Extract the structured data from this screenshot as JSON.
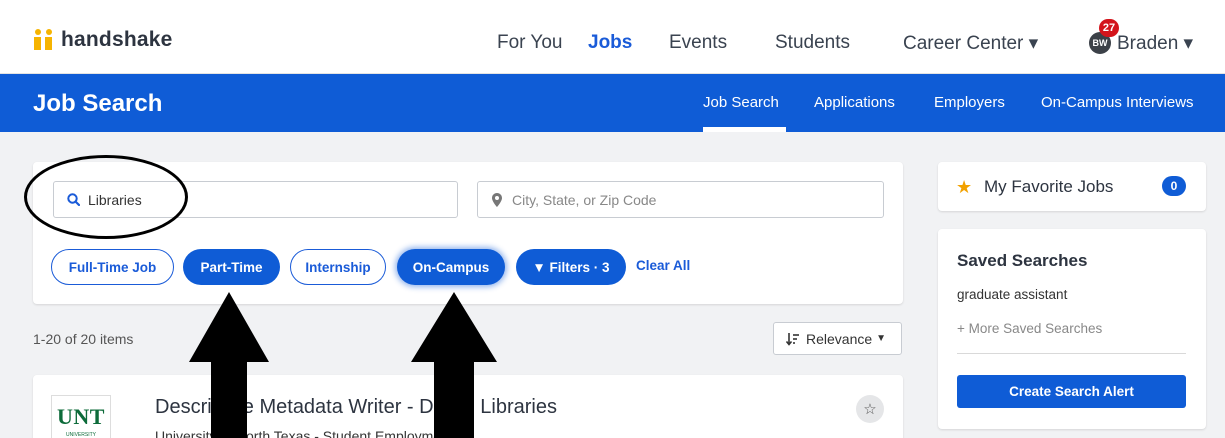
{
  "brand": {
    "name": "handshake"
  },
  "topnav": {
    "items": [
      {
        "label": "For You"
      },
      {
        "label": "Jobs"
      },
      {
        "label": "Events"
      },
      {
        "label": "Students"
      },
      {
        "label": "Career Center ▾"
      }
    ],
    "user": {
      "initials": "BW",
      "name": "Braden ▾",
      "notifications": "27"
    }
  },
  "bluebar": {
    "title": "Job Search",
    "tabs": [
      {
        "label": "Job Search"
      },
      {
        "label": "Applications"
      },
      {
        "label": "Employers"
      },
      {
        "label": "On-Campus Interviews"
      }
    ]
  },
  "search": {
    "query_value": "Libraries",
    "location_placeholder": "City, State, or Zip Code",
    "filters": [
      {
        "label": "Full-Time Job",
        "selected": false
      },
      {
        "label": "Part-Time",
        "selected": true
      },
      {
        "label": "Internship",
        "selected": false
      },
      {
        "label": "On-Campus",
        "selected": true
      },
      {
        "label": "▼ Filters · 3",
        "selected": true
      }
    ],
    "clear_all": "Clear All"
  },
  "results": {
    "count_label": "1-20 of 20 items",
    "sort_label": "Relevance"
  },
  "job": {
    "logo_text": "UNT",
    "logo_subtext": "UNIVERSITY",
    "title": "Descriptive Metadata Writer - Digital Libraries",
    "company": "University of North Texas - Student Employment"
  },
  "sidebar": {
    "favorites_label": "My Favorite Jobs",
    "favorites_count": "0",
    "saved_title": "Saved Searches",
    "saved_items": [
      "graduate assistant"
    ],
    "more_saved": "+ More Saved Searches",
    "create_alert": "Create Search Alert"
  },
  "colors": {
    "primary": "#0f5cd6",
    "brand_yellow": "#f6b400",
    "notification": "#d3141b"
  },
  "icons": [
    "search-icon",
    "location-pin-icon",
    "filter-icon",
    "sort-icon",
    "star-icon",
    "caret-down-icon"
  ]
}
